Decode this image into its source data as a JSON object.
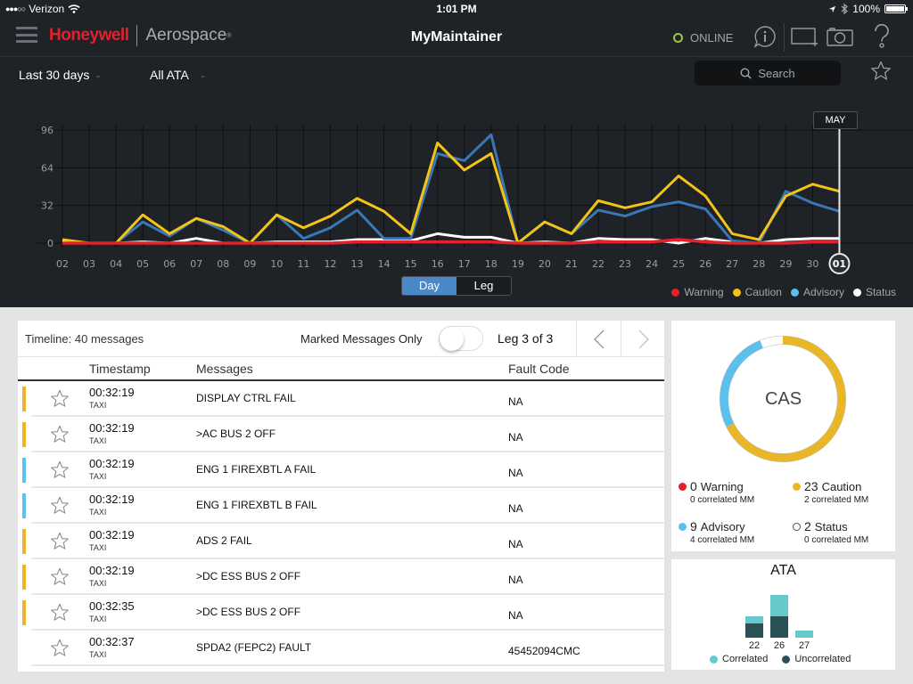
{
  "status_bar": {
    "carrier": "Verizon",
    "signal_dots": "●●●○○",
    "time": "1:01 PM",
    "battery": "100%",
    "battery_level": 1.0
  },
  "nav": {
    "brand_primary": "Honeywell",
    "brand_secondary": "Aerospace",
    "brand_mark": "®",
    "app_title": "MyMaintainer",
    "connection_status": "ONLINE",
    "icons": [
      "menu-icon",
      "info-icon",
      "screen-capture-icon",
      "camera-icon",
      "help-icon"
    ]
  },
  "filters": {
    "date_range": "Last 30 days",
    "ata_filter": "All ATA",
    "search_placeholder": "Search"
  },
  "view_toggle": {
    "options": [
      "Day",
      "Leg"
    ],
    "selected": "Day"
  },
  "chart_data": {
    "type": "line",
    "title": "",
    "xlabel": "",
    "ylabel": "",
    "x": [
      "02",
      "03",
      "04",
      "05",
      "06",
      "07",
      "08",
      "09",
      "10",
      "11",
      "12",
      "13",
      "14",
      "15",
      "16",
      "17",
      "18",
      "19",
      "20",
      "21",
      "22",
      "23",
      "24",
      "25",
      "26",
      "27",
      "28",
      "29",
      "30",
      "01"
    ],
    "yticks": [
      0,
      32,
      64,
      96
    ],
    "ylim": [
      0,
      96
    ],
    "grid": true,
    "selected_x": "01",
    "selected_month_label": "MAY",
    "legend_position": "bottom-right",
    "series": [
      {
        "name": "Warning",
        "color": "#e4212b",
        "values": [
          0,
          0,
          0,
          0,
          0,
          0,
          0,
          0,
          0,
          0,
          0,
          1,
          1,
          1,
          1,
          1,
          1,
          0,
          0,
          0,
          1,
          1,
          1,
          3,
          1,
          0,
          0,
          0,
          1,
          1
        ]
      },
      {
        "name": "Caution",
        "color": "#f2c318",
        "values": [
          3,
          0,
          0,
          24,
          8,
          21,
          14,
          0,
          24,
          13,
          23,
          38,
          27,
          8,
          85,
          62,
          76,
          0,
          18,
          8,
          36,
          30,
          35,
          57,
          40,
          8,
          3,
          40,
          50,
          44
        ]
      },
      {
        "name": "Advisory",
        "color": "#3a78b5",
        "values": [
          0,
          0,
          0,
          18,
          6,
          21,
          11,
          0,
          24,
          4,
          13,
          28,
          4,
          4,
          76,
          70,
          92,
          0,
          18,
          8,
          28,
          23,
          31,
          35,
          29,
          2,
          0,
          44,
          34,
          27
        ]
      },
      {
        "name": "Status",
        "color": "#ffffff",
        "values": [
          1,
          0,
          0,
          1,
          0,
          4,
          0,
          0,
          1,
          1,
          1,
          3,
          3,
          2,
          8,
          5,
          5,
          0,
          1,
          0,
          4,
          3,
          3,
          0,
          4,
          1,
          0,
          3,
          4,
          4
        ]
      }
    ]
  },
  "legend": [
    {
      "label": "Warning",
      "color": "#e4212b"
    },
    {
      "label": "Caution",
      "color": "#f2c318"
    },
    {
      "label": "Advisory",
      "color": "#5bc0eb"
    },
    {
      "label": "Status",
      "color": "#ffffff"
    }
  ],
  "timeline": {
    "title": "Timeline: 40 messages",
    "marked_only_label": "Marked Messages Only",
    "marked_only": false,
    "leg_indicator": "Leg 3 of 3",
    "columns": [
      "Timestamp",
      "Messages",
      "Fault Code"
    ],
    "rows": [
      {
        "time": "00:32:19",
        "phase": "TAXI",
        "message": "DISPLAY CTRL FAIL",
        "fault_code": "NA",
        "severity_color": "#f0b323"
      },
      {
        "time": "00:32:19",
        "phase": "TAXI",
        "message": ">AC BUS 2 OFF",
        "fault_code": "NA",
        "severity_color": "#f0b323"
      },
      {
        "time": "00:32:19",
        "phase": "TAXI",
        "message": "ENG 1 FIREXBTL A FAIL",
        "fault_code": "NA",
        "severity_color": "#5bc0eb"
      },
      {
        "time": "00:32:19",
        "phase": "TAXI",
        "message": "ENG 1 FIREXBTL B FAIL",
        "fault_code": "NA",
        "severity_color": "#5bc0eb"
      },
      {
        "time": "00:32:19",
        "phase": "TAXI",
        "message": "ADS 2 FAIL",
        "fault_code": "NA",
        "severity_color": "#f0b323"
      },
      {
        "time": "00:32:19",
        "phase": "TAXI",
        "message": ">DC ESS BUS 2 OFF",
        "fault_code": "NA",
        "severity_color": "#f0b323"
      },
      {
        "time": "00:32:35",
        "phase": "TAXI",
        "message": ">DC ESS BUS 2 OFF",
        "fault_code": "NA",
        "severity_color": "#f0b323"
      },
      {
        "time": "00:32:37",
        "phase": "TAXI",
        "message": "SPDA2 (FEPC2) FAULT",
        "fault_code": "45452094CMC",
        "severity_color": ""
      }
    ]
  },
  "cas": {
    "title": "CAS",
    "items": [
      {
        "count": "0",
        "label": "Warning",
        "sub": "0 correlated MM",
        "color": "#e4212b"
      },
      {
        "count": "23",
        "label": "Caution",
        "sub": "2 correlated MM",
        "color": "#e9b626"
      },
      {
        "count": "9",
        "label": "Advisory",
        "sub": "4 correlated MM",
        "color": "#5bc0eb"
      },
      {
        "count": "2",
        "label": "Status",
        "sub": "0 correlated MM",
        "color": "#ffffff"
      }
    ]
  },
  "ata": {
    "title": "ATA",
    "categories": [
      "22",
      "26",
      "27"
    ],
    "correlated": [
      1,
      3,
      1
    ],
    "uncorrelated": [
      2,
      3,
      0
    ],
    "legend": [
      {
        "label": "Correlated",
        "color": "#67c9cc"
      },
      {
        "label": "Uncorrelated",
        "color": "#2a5256"
      }
    ]
  }
}
